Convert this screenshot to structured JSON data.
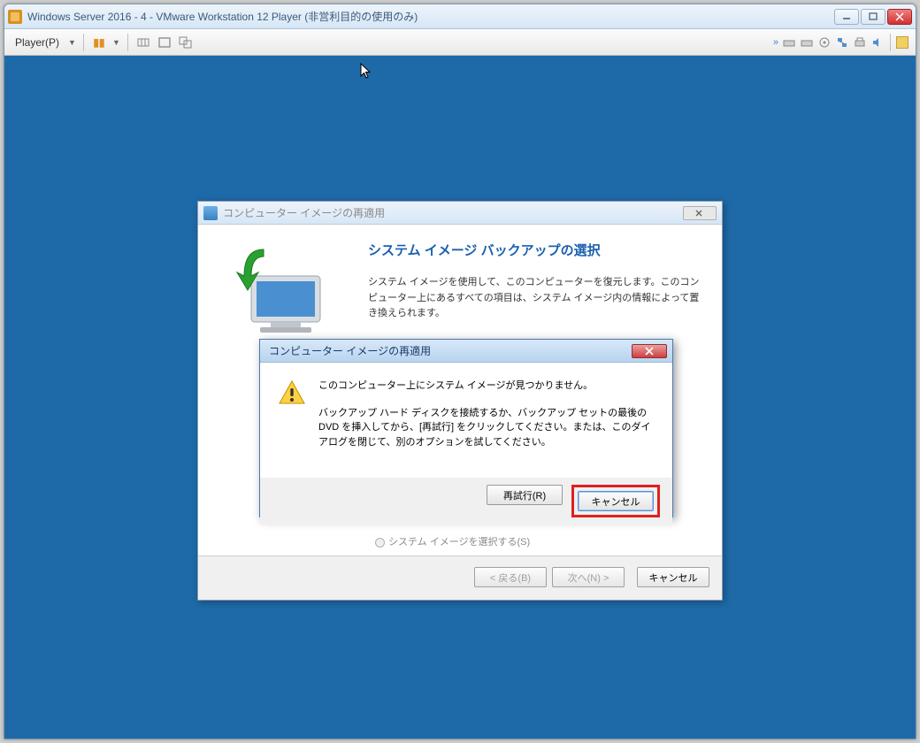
{
  "vmware": {
    "title": "Windows Server 2016 - 4 - VMware Workstation 12 Player (非営利目的の使用のみ)",
    "player_menu": "Player(P)"
  },
  "wizard": {
    "title": "コンピューター イメージの再適用",
    "heading": "システム イメージ バックアップの選択",
    "paragraph": "システム イメージを使用して、このコンピューターを復元します。このコンピューター上にあるすべての項目は、システム イメージ内の情報によって置き換えられます。",
    "radio_select": "システム イメージを選択する(S)",
    "back": "< 戻る(B)",
    "next": "次へ(N) >",
    "cancel": "キャンセル"
  },
  "alert": {
    "title": "コンピューター イメージの再適用",
    "heading": "このコンピューター上にシステム イメージが見つかりません。",
    "body": "バックアップ ハード ディスクを接続するか、バックアップ セットの最後の DVD を挿入してから、[再試行] をクリックしてください。または、このダイアログを閉じて、別のオプションを試してください。",
    "retry": "再試行(R)",
    "cancel": "キャンセル"
  }
}
